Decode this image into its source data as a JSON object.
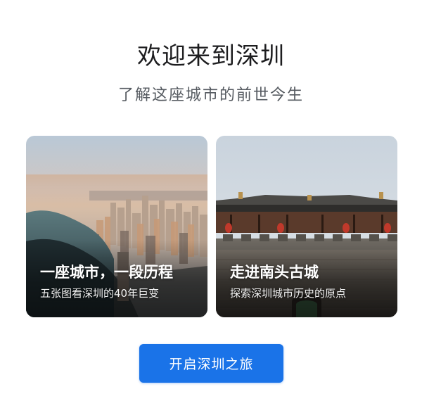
{
  "header": {
    "title": "欢迎来到深圳",
    "subtitle": "了解这座城市的前世今生"
  },
  "cards": [
    {
      "title": "一座城市，一段历程",
      "description": "五张图看深圳的40年巨变"
    },
    {
      "title": "走进南头古城",
      "description": "探索深圳城市历史的原点"
    }
  ],
  "cta": {
    "label": "开启深圳之旅"
  },
  "colors": {
    "accent": "#1a73e8",
    "title_text": "#1d1d1f",
    "subtitle_text": "#555a60"
  }
}
